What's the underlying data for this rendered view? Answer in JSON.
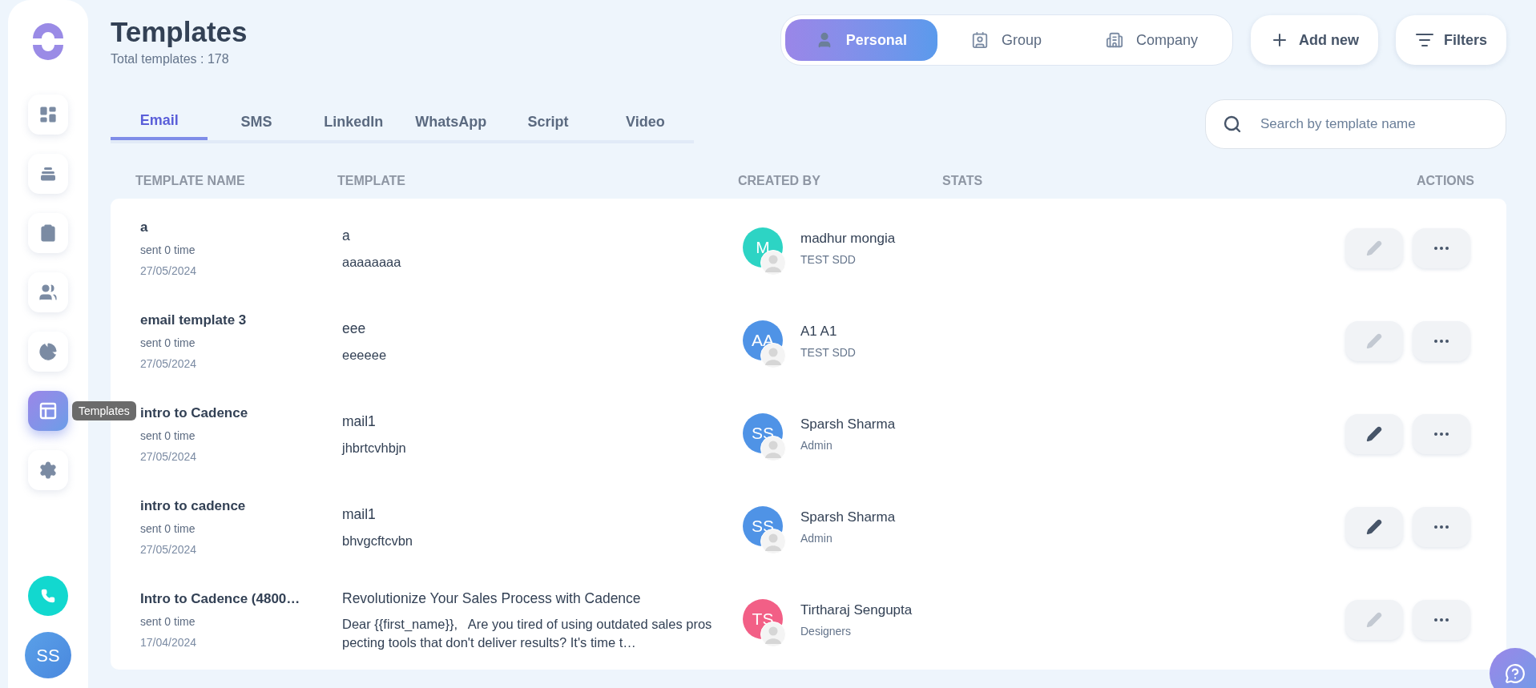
{
  "sidebar": {
    "items": [
      {
        "kind": "dashboard",
        "selected": false
      },
      {
        "kind": "tray",
        "selected": false
      },
      {
        "kind": "clipboard",
        "selected": false
      },
      {
        "kind": "people",
        "selected": false
      },
      {
        "kind": "pie",
        "selected": false
      },
      {
        "kind": "templates",
        "selected": true
      },
      {
        "kind": "settings",
        "selected": false
      }
    ],
    "tooltip": "Templates",
    "user_avatar": "SS"
  },
  "header": {
    "title": "Templates",
    "subtitle": "Total templates : 178"
  },
  "scope": [
    {
      "kind": "person",
      "label": "Personal",
      "selected": true
    },
    {
      "kind": "badge",
      "label": "Group",
      "selected": false
    },
    {
      "kind": "building",
      "label": "Company",
      "selected": false
    }
  ],
  "buttons": [
    {
      "kind": "add",
      "label": "Add new"
    },
    {
      "kind": "filter",
      "label": "Filters"
    }
  ],
  "tabs": [
    {
      "label": "Email",
      "selected": true
    },
    {
      "label": "SMS",
      "selected": false
    },
    {
      "label": "LinkedIn",
      "selected": false
    },
    {
      "label": "WhatsApp",
      "selected": false
    },
    {
      "label": "Script",
      "selected": false
    },
    {
      "label": "Video",
      "selected": false
    }
  ],
  "search": {
    "placeholder": "Search by template name"
  },
  "table": {
    "columns": [
      "TEMPLATE NAME",
      "TEMPLATE",
      "CREATED BY",
      "STATS",
      "ACTIONS"
    ],
    "rows": [
      {
        "name": "a",
        "sent": "sent 0 time",
        "date": "27/05/2024",
        "subject": "a",
        "body": "aaaaaaaa",
        "initials": "M",
        "color": "#2dd4c4",
        "creator": "madhur mongia",
        "team": "TEST SDD",
        "edit_disabled": true
      },
      {
        "name": "email template 3",
        "sent": "sent 0 time",
        "date": "27/05/2024",
        "subject": "eee",
        "body": "eeeeee",
        "initials": "AA",
        "color": "#4f93e6",
        "creator": "A1 A1",
        "team": "TEST SDD",
        "edit_disabled": true
      },
      {
        "name": "intro to Cadence",
        "sent": "sent 0 time",
        "date": "27/05/2024",
        "subject": "mail1",
        "body": "jhbrtcvhbjn",
        "initials": "SS",
        "color": "#4f93e6",
        "creator": "Sparsh Sharma",
        "team": "Admin",
        "edit_disabled": false
      },
      {
        "name": "intro to cadence",
        "sent": "sent 0 time",
        "date": "27/05/2024",
        "subject": "mail1",
        "body": "bhvgcftcvbn",
        "initials": "SS",
        "color": "#4f93e6",
        "creator": "Sparsh Sharma",
        "team": "Admin",
        "edit_disabled": false
      },
      {
        "name": "Intro to Cadence (4800…",
        "sent": "sent 0 time",
        "date": "17/04/2024",
        "subject": "Revolutionize Your Sales Process with Cadence",
        "body": "Dear {{first_name}},   Are you tired of using outdated sales prospecting tools that don't deliver results? It's time t…",
        "initials": "TS",
        "color": "#f25f86",
        "creator": "Tirtharaj Sengupta",
        "team": "Designers",
        "edit_disabled": true
      }
    ]
  }
}
